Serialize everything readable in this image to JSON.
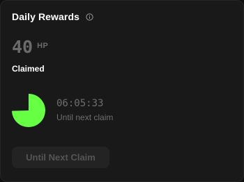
{
  "card": {
    "title": "Daily Rewards",
    "info_icon": "info-icon",
    "points_value": "40",
    "points_unit": "HP",
    "status": "Claimed",
    "timer": {
      "time": "06:05:33",
      "label": "Until next claim",
      "progress_fraction": 0.746
    },
    "button_label": "Until Next Claim"
  },
  "colors": {
    "accent": "#66ff44",
    "card_bg": "#191919",
    "muted_text": "#6e6e6e",
    "button_bg": "#232323"
  }
}
